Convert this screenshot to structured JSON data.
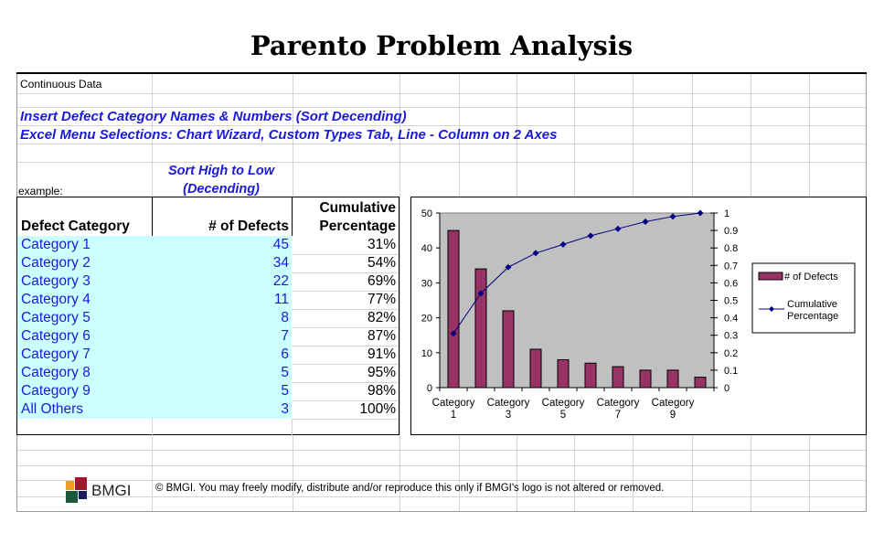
{
  "title": "Parento Problem Analysis",
  "subtitle_label": "Continuous Data",
  "instructions": [
    "Insert Defect Category Names & Numbers (Sort Decending)",
    "Excel Menu Selections: Chart Wizard, Custom Types Tab, Line - Column on 2 Axes"
  ],
  "example_label": "example:",
  "sort_note": {
    "line1": "Sort High to Low",
    "line2": "(Decending)"
  },
  "table": {
    "headers": {
      "category": "Defect Category",
      "defects": "# of Defects",
      "cumulative_line1": "Cumulative",
      "cumulative_line2": "Percentage"
    },
    "rows": [
      {
        "category": "Category 1",
        "defects": "45",
        "cumulative": "31%"
      },
      {
        "category": "Category 2",
        "defects": "34",
        "cumulative": "54%"
      },
      {
        "category": "Category 3",
        "defects": "22",
        "cumulative": "69%"
      },
      {
        "category": "Category 4",
        "defects": "11",
        "cumulative": "77%"
      },
      {
        "category": "Category 5",
        "defects": "8",
        "cumulative": "82%"
      },
      {
        "category": "Category 6",
        "defects": "7",
        "cumulative": "87%"
      },
      {
        "category": "Category 7",
        "defects": "6",
        "cumulative": "91%"
      },
      {
        "category": "Category 8",
        "defects": "5",
        "cumulative": "95%"
      },
      {
        "category": "Category 9",
        "defects": "5",
        "cumulative": "98%"
      },
      {
        "category": "All Others",
        "defects": "3",
        "cumulative": "100%"
      }
    ]
  },
  "colors": {
    "bar": "#993366",
    "line": "#000080",
    "plot_bg": "#c0c0c0",
    "blue_text": "#1a1ad8",
    "table_fill": "#ccffff"
  },
  "chart_data": {
    "type": "bar",
    "title": "",
    "categories": [
      "Category 1",
      "Category 2",
      "Category 3",
      "Category 4",
      "Category 5",
      "Category 6",
      "Category 7",
      "Category 8",
      "Category 9",
      "All Others"
    ],
    "x_tick_labels": [
      {
        "line1": "Category",
        "line2": "1"
      },
      {
        "line1": "Category",
        "line2": "3"
      },
      {
        "line1": "Category",
        "line2": "5"
      },
      {
        "line1": "Category",
        "line2": "7"
      },
      {
        "line1": "Category",
        "line2": "9"
      }
    ],
    "series": [
      {
        "name": "# of Defects",
        "type": "bar",
        "axis": "left",
        "values": [
          45,
          34,
          22,
          11,
          8,
          7,
          6,
          5,
          5,
          3
        ]
      },
      {
        "name": "Cumulative Percentage",
        "type": "line",
        "axis": "right",
        "values": [
          0.31,
          0.54,
          0.69,
          0.77,
          0.82,
          0.87,
          0.91,
          0.95,
          0.98,
          1.0
        ]
      }
    ],
    "y_left": {
      "range": [
        0,
        50
      ],
      "ticks": [
        "0",
        "10",
        "20",
        "30",
        "40",
        "50"
      ]
    },
    "y_right": {
      "range": [
        0,
        1
      ],
      "ticks": [
        "0",
        "0.1",
        "0.2",
        "0.3",
        "0.4",
        "0.5",
        "0.6",
        "0.7",
        "0.8",
        "0.9",
        "1"
      ]
    },
    "grid": false,
    "legend": {
      "position": "right",
      "entries": [
        {
          "label": "# of Defects"
        },
        {
          "label_line1": "Cumulative",
          "label_line2": "Percentage"
        }
      ]
    }
  },
  "footer": {
    "logo_text": "BMGI",
    "copyright": "© BMGI. You may freely modify, distribute and/or reproduce this only if BMGI's logo is not altered or removed."
  }
}
